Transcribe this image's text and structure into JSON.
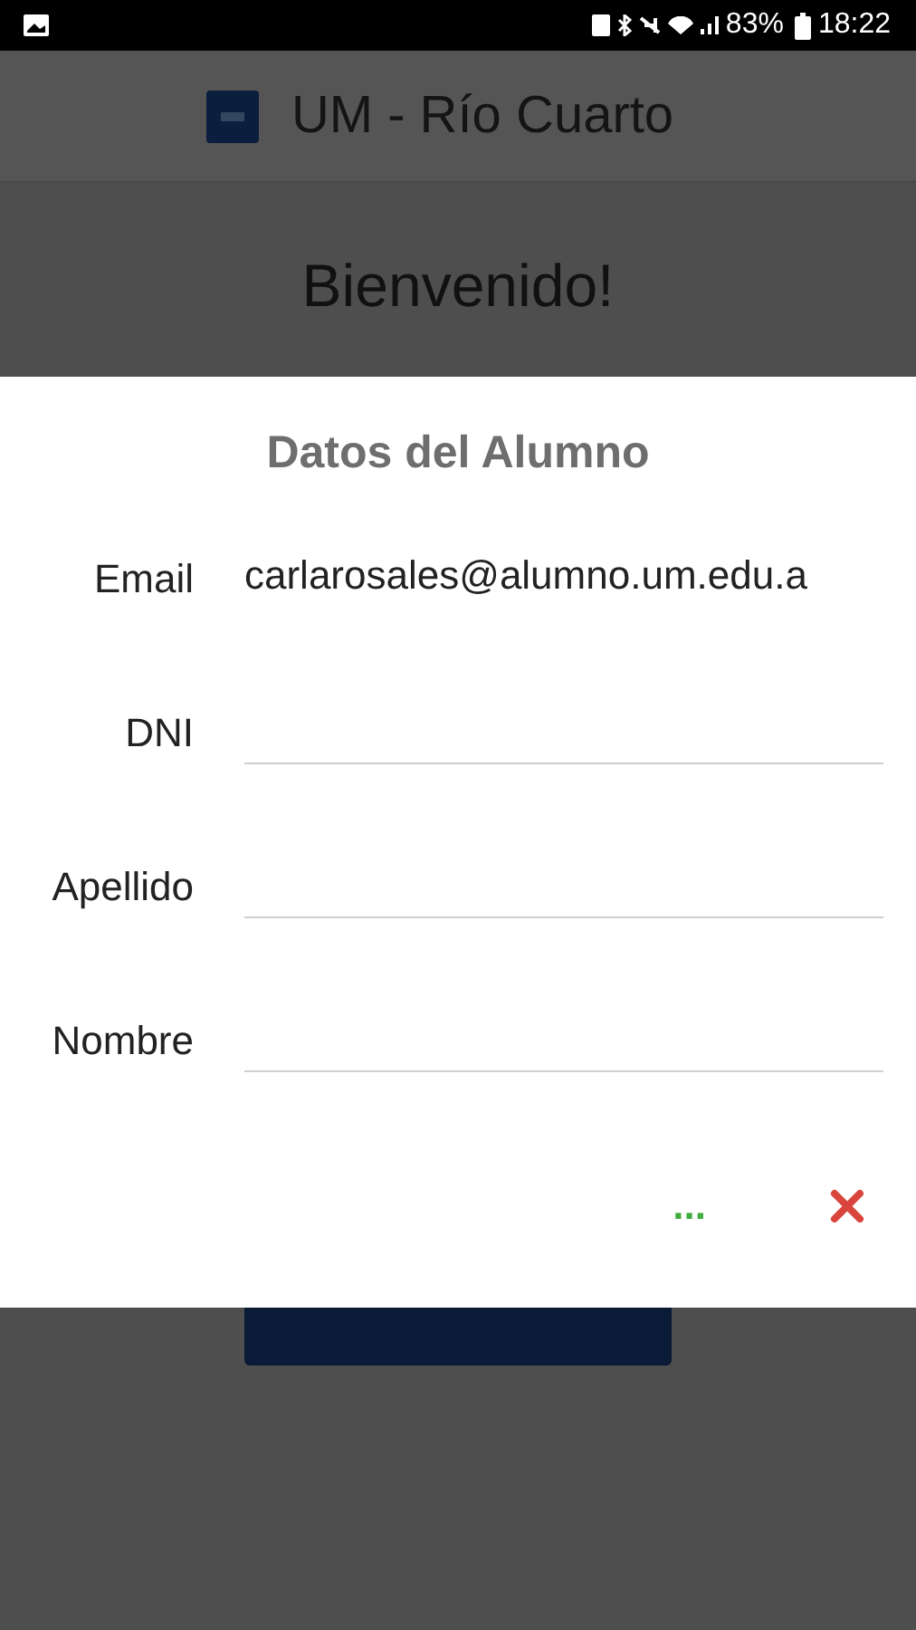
{
  "status_bar": {
    "battery": "83%",
    "time": "18:22"
  },
  "app_bar": {
    "title": "UM - Río Cuarto"
  },
  "page": {
    "heading": "Bienvenido!"
  },
  "dialog": {
    "title": "Datos del Alumno",
    "fields": [
      {
        "label": "Email",
        "value": "carlarosales@alumno.um.edu.a"
      },
      {
        "label": "DNI"
      },
      {
        "label": "Apellido"
      },
      {
        "label": "Nombre"
      }
    ],
    "confirm": "..."
  }
}
